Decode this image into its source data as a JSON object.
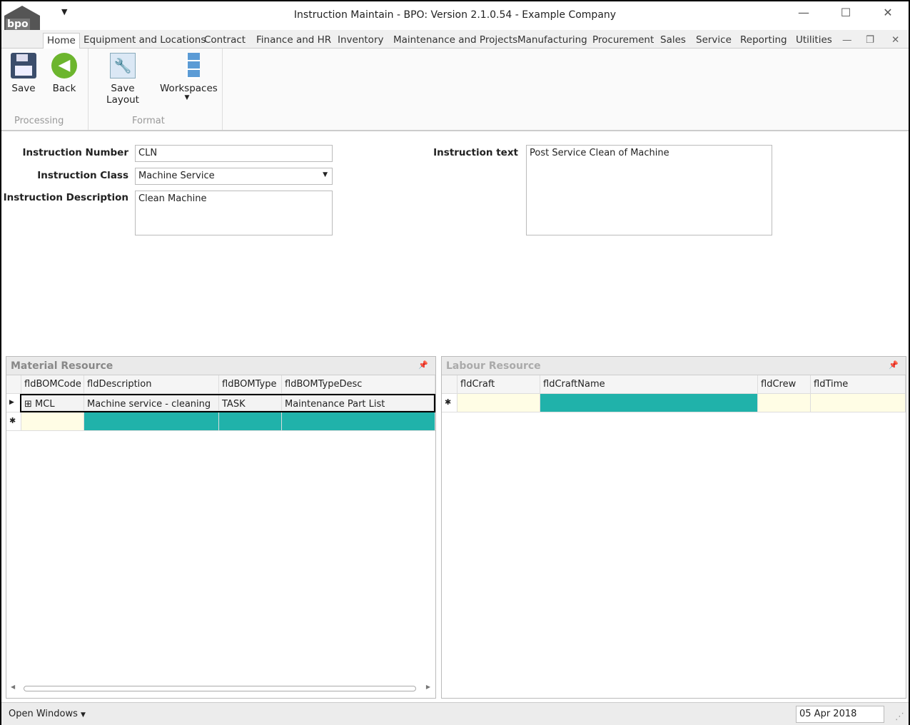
{
  "window": {
    "title": "Instruction Maintain - BPO: Version 2.1.0.54 - Example Company",
    "logo_text": "bpo"
  },
  "tabs": [
    "Home",
    "Equipment and Locations",
    "Contract",
    "Finance and HR",
    "Inventory",
    "Maintenance and Projects",
    "Manufacturing",
    "Procurement",
    "Sales",
    "Service",
    "Reporting",
    "Utilities"
  ],
  "ribbon": {
    "save": "Save",
    "back": "Back",
    "save_layout": "Save Layout",
    "workspaces": "Workspaces",
    "group_processing": "Processing",
    "group_format": "Format"
  },
  "form": {
    "instruction_number_label": "Instruction Number",
    "instruction_number": "CLN",
    "instruction_class_label": "Instruction Class",
    "instruction_class": "Machine Service",
    "instruction_description_label": "Instruction Description",
    "instruction_description": "Clean Machine",
    "instruction_text_label": "Instruction text",
    "instruction_text": "Post Service Clean of Machine"
  },
  "material": {
    "title": "Material Resource",
    "columns": [
      "fldBOMCode",
      "fldDescription",
      "fldBOMType",
      "fldBOMTypeDesc"
    ],
    "rows": [
      [
        "MCL",
        "Machine service - cleaning",
        "TASK",
        "Maintenance Part List"
      ]
    ]
  },
  "labour": {
    "title": "Labour Resource",
    "columns": [
      "fldCraft",
      "fldCraftName",
      "fldCrew",
      "fldTime"
    ]
  },
  "status": {
    "open_windows": "Open Windows",
    "date": "05 Apr 2018"
  },
  "colors": {
    "new_row_teal": "#20b2aa",
    "new_row_cream": "#fffde5"
  }
}
